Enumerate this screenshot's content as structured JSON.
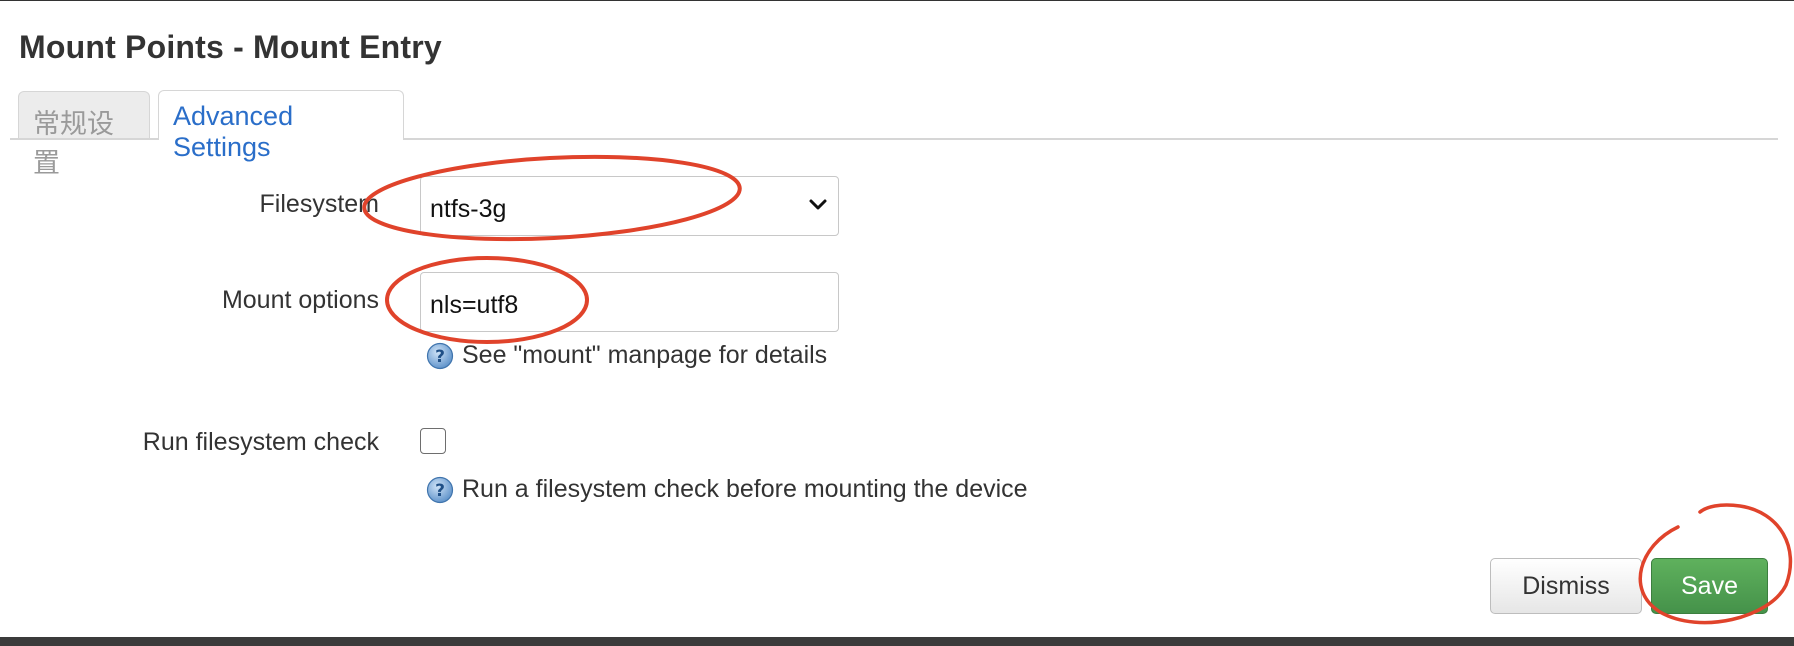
{
  "dialog": {
    "title": "Mount Points - Mount Entry"
  },
  "tabs": [
    {
      "label": "常规设置",
      "active": false
    },
    {
      "label": "Advanced Settings",
      "active": true
    }
  ],
  "form": {
    "filesystem": {
      "label": "Filesystem",
      "value": "ntfs-3g"
    },
    "mount_options": {
      "label": "Mount options",
      "value": "nls=utf8",
      "help": "See \"mount\" manpage for details"
    },
    "fs_check": {
      "label": "Run filesystem check",
      "checked": false,
      "help": "Run a filesystem check before mounting the device"
    }
  },
  "buttons": {
    "dismiss": "Dismiss",
    "save": "Save"
  },
  "colors": {
    "tab_active_text": "#2a6ec9",
    "save_button": "#4e9f4f",
    "annotation": "#e0432b"
  },
  "icons": [
    "help-icon",
    "chevron-down-icon"
  ]
}
